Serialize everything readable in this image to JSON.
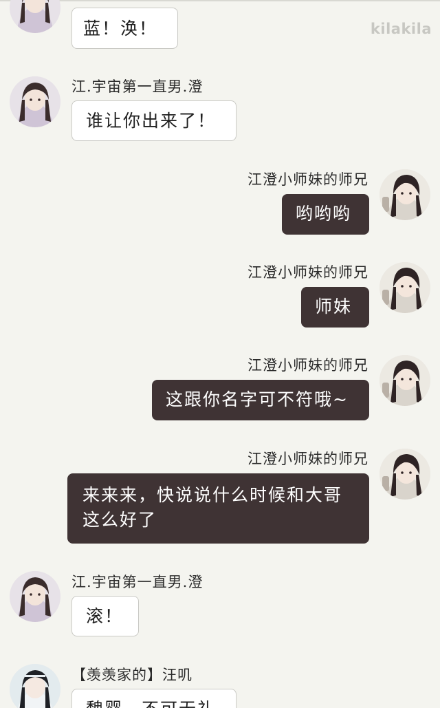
{
  "app": {
    "watermark": "kilakila"
  },
  "messages": [
    {
      "id": "m1",
      "side": "left",
      "sender": "",
      "text": "蓝！涣！"
    },
    {
      "id": "m2",
      "side": "left",
      "sender": "江.宇宙第一直男.澄",
      "text": "谁让你出来了！"
    },
    {
      "id": "m3",
      "side": "right",
      "sender": "江澄小师妹的师兄",
      "text": "哟哟哟"
    },
    {
      "id": "m4",
      "side": "right",
      "sender": "江澄小师妹的师兄",
      "text": "师妹"
    },
    {
      "id": "m5",
      "side": "right",
      "sender": "江澄小师妹的师兄",
      "text": "这跟你名字可不符哦~"
    },
    {
      "id": "m6",
      "side": "right",
      "sender": "江澄小师妹的师兄",
      "text": "来来来，快说说什么时候和大哥这么好了"
    },
    {
      "id": "m7",
      "side": "left",
      "sender": "江.宇宙第一直男.澄",
      "text": "滚！"
    },
    {
      "id": "m8",
      "side": "left",
      "sender": "【羡羡家的】汪叽",
      "text": "魏婴，不可无礼"
    }
  ],
  "colors": {
    "background": "#f4f4ef",
    "bubble_left": "#ffffff",
    "bubble_right": "#3f3334",
    "watermark": "#c7c7c2"
  }
}
